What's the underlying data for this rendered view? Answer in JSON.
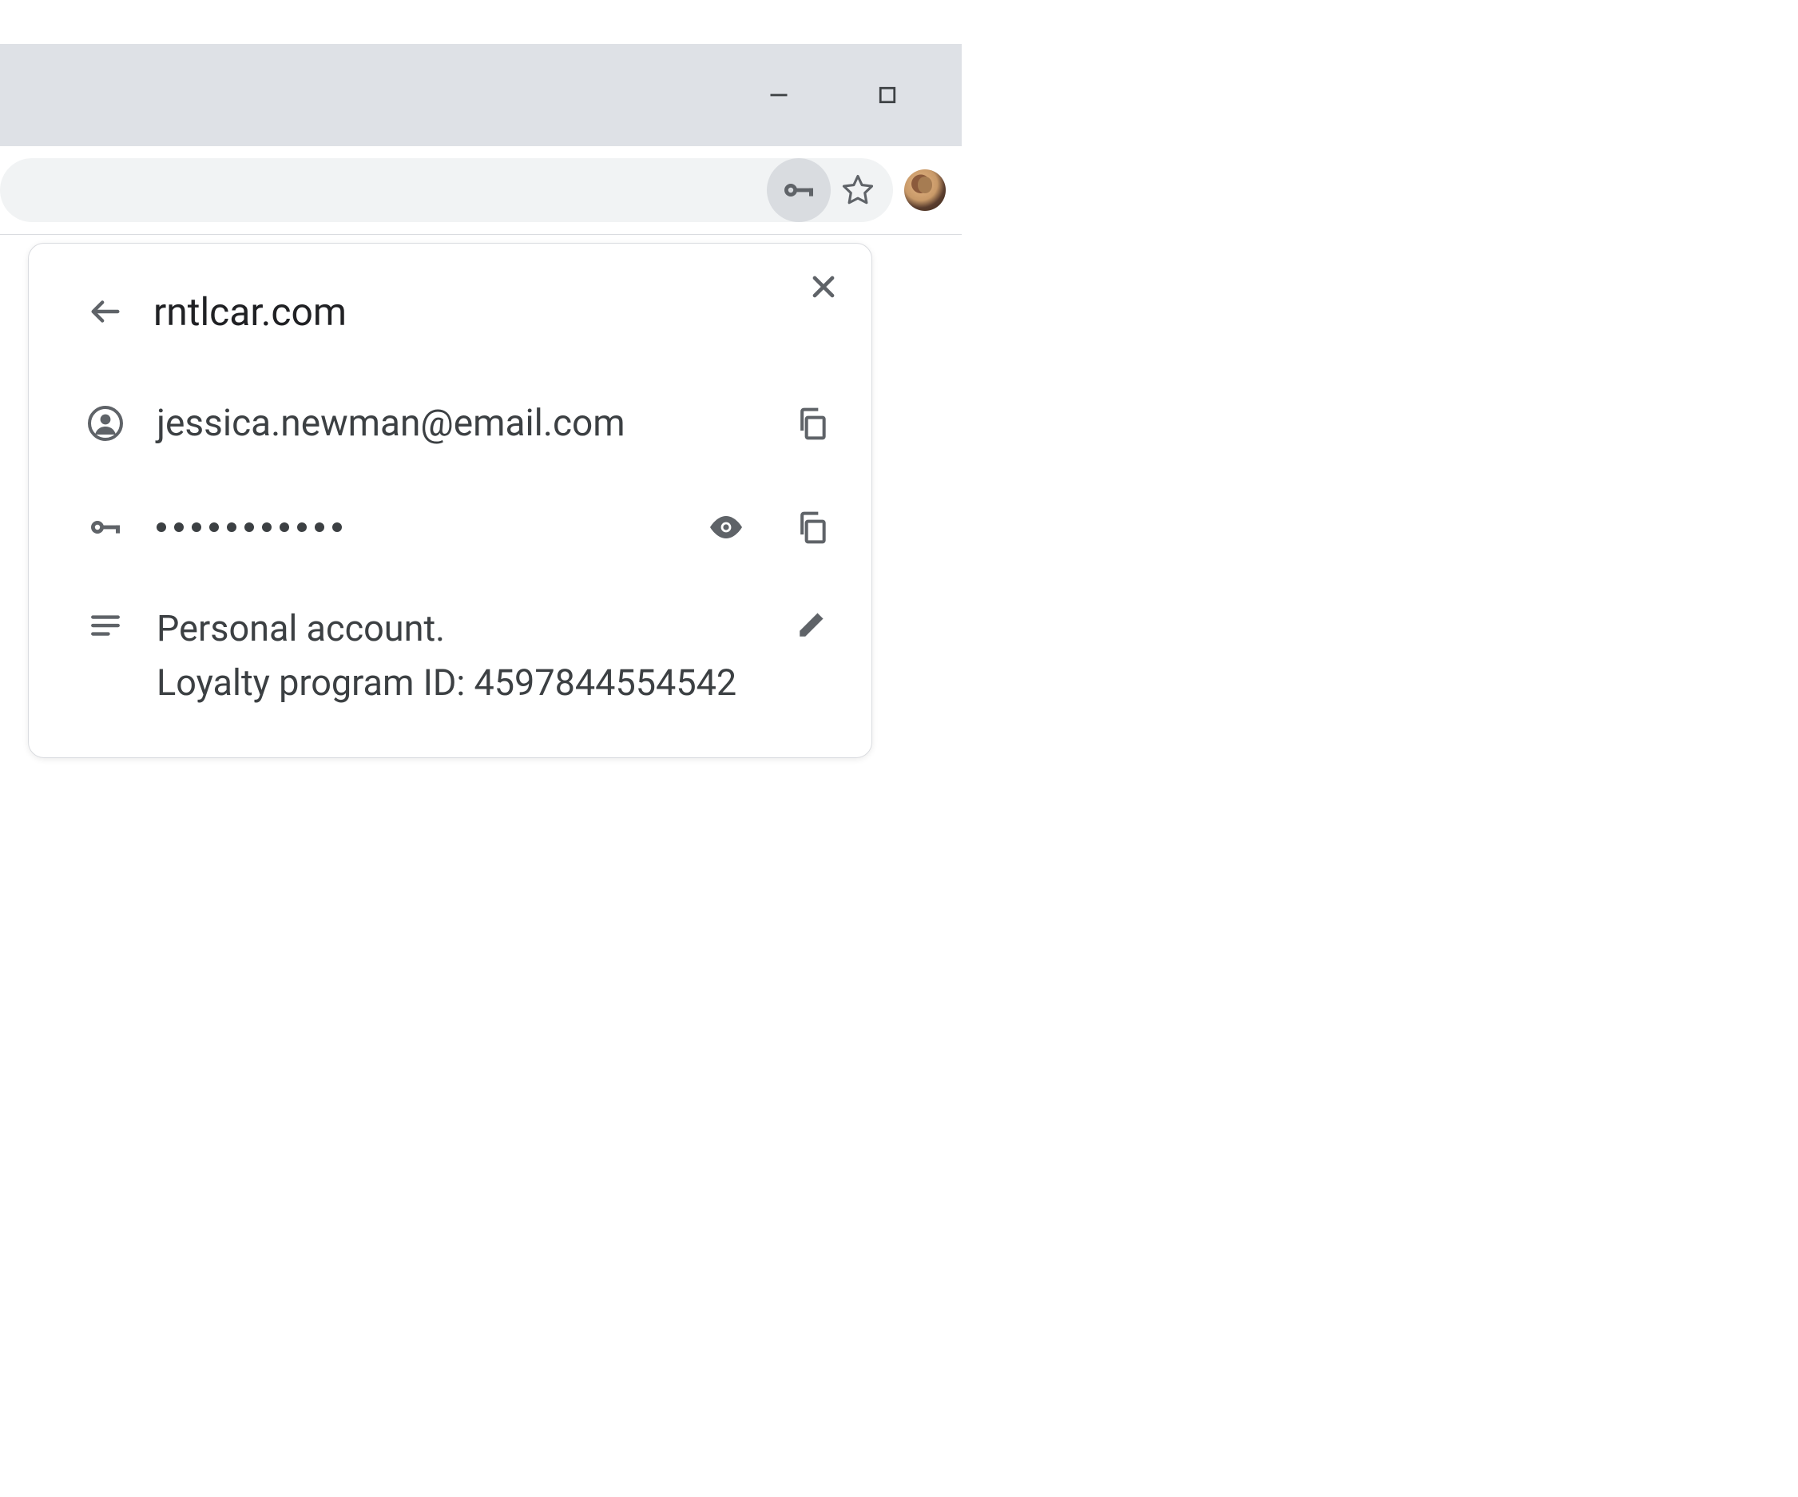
{
  "popup": {
    "site": "rntlcar.com",
    "username": "jessica.newman@email.com",
    "passwordMask": "•••••••••••",
    "dotCount": 11,
    "noteLine1": "Personal account.",
    "noteLine2": "Loyalty program ID: 4597844554542"
  },
  "icons": {
    "back": "back-arrow",
    "close": "close",
    "person": "person",
    "key": "key",
    "eye": "visibility",
    "copy": "copy",
    "notes": "notes",
    "edit": "edit",
    "star": "star",
    "minimize": "minimize",
    "maximize": "maximize"
  }
}
